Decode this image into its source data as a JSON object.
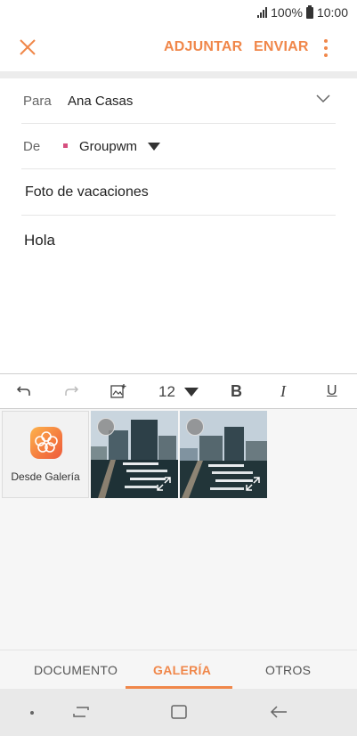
{
  "status": {
    "battery": "100%",
    "time": "10:00"
  },
  "toolbar": {
    "attach_label": "ADJUNTAR",
    "send_label": "ENVIAR"
  },
  "compose": {
    "to_label": "Para",
    "to_value": "Ana Casas",
    "from_label": "De",
    "from_value": "Groupwm",
    "subject": "Foto de vacaciones",
    "body": "Hola"
  },
  "format": {
    "font_size": "12",
    "bold": "B",
    "italic": "I",
    "underline": "U"
  },
  "media": {
    "gallery_label": "Desde Galería"
  },
  "tabs": [
    {
      "label": "DOCUMENTO"
    },
    {
      "label": "GALERÍA"
    },
    {
      "label": "OTROS"
    }
  ],
  "colors": {
    "accent": "#f0874a",
    "account_dot": "#d64f7f"
  }
}
